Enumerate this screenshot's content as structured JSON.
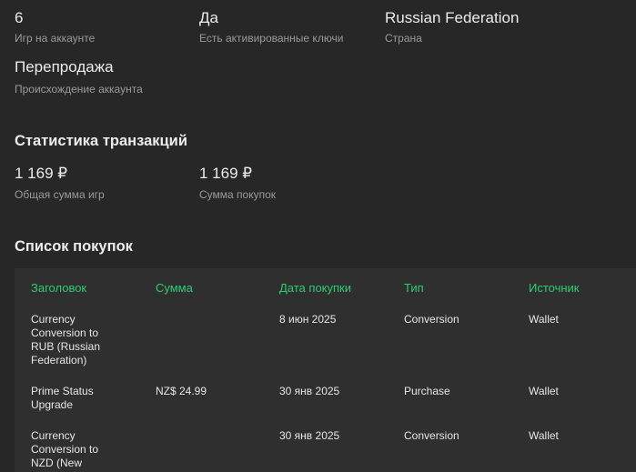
{
  "account": {
    "games": {
      "value": "6",
      "label": "Игр на аккаунте"
    },
    "keys": {
      "value": "Да",
      "label": "Есть активированные ключи"
    },
    "country": {
      "value": "Russian Federation",
      "label": "Страна"
    },
    "origin": {
      "value": "Перепродажа",
      "label": "Происхождение аккаунта"
    }
  },
  "transactions": {
    "title": "Статистика транзакций",
    "games_total": {
      "value": "1 169 ₽",
      "label": "Общая сумма игр"
    },
    "purchases_total": {
      "value": "1 169 ₽",
      "label": "Сумма покупок"
    }
  },
  "purchases": {
    "title": "Список покупок",
    "columns": [
      "Заголовок",
      "Сумма",
      "Дата покупки",
      "Тип",
      "Источник"
    ],
    "rows": [
      {
        "title": "Currency Conversion to RUB (Russian Federation)",
        "amount": "",
        "date": "8 июн 2025",
        "type": "Conversion",
        "source": "Wallet"
      },
      {
        "title": "Prime Status Upgrade",
        "amount": "NZ$ 24.99",
        "date": "30 янв 2025",
        "type": "Purchase",
        "source": "Wallet"
      },
      {
        "title": "Currency Conversion to NZD (New",
        "amount": "",
        "date": "30 янв 2025",
        "type": "Conversion",
        "source": "Wallet"
      }
    ]
  },
  "colors": {
    "background": "#272727",
    "panel": "#2f2f2f",
    "accent_green": "#2ecc71",
    "label_gray": "#9a9a9a"
  }
}
